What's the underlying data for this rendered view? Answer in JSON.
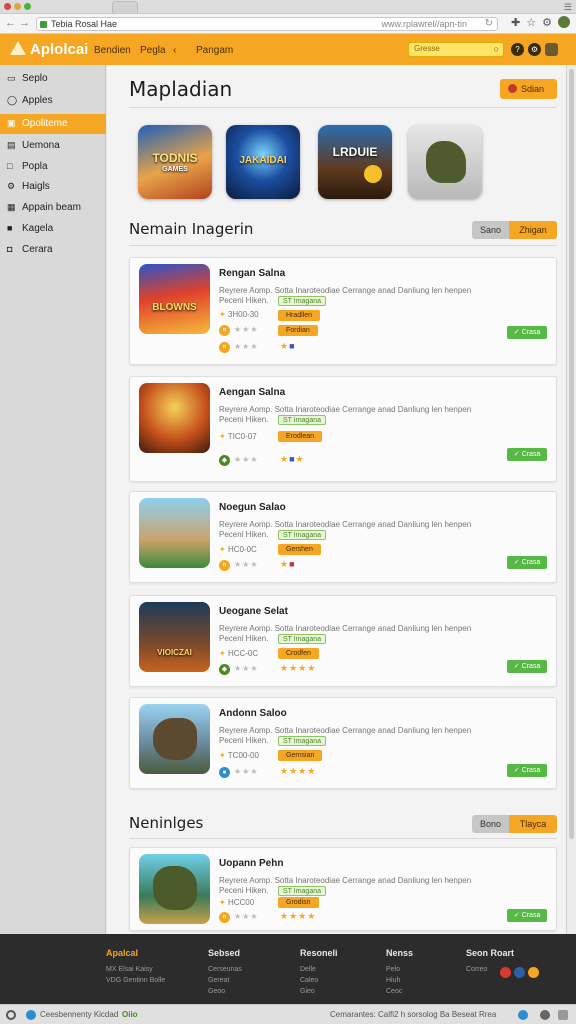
{
  "browser": {
    "tab_title": "Tebia Rosal Hae",
    "url": "www.rplawrel//apn-tin",
    "back_icon": "arrow-left-icon",
    "forward_icon": "arrow-right-icon"
  },
  "header": {
    "logo": "Aplolcai",
    "nav": [
      "Bendien",
      "Pegla"
    ],
    "nav_right": "Pangam",
    "search_placeholder": "Gresse"
  },
  "sidebar": {
    "items": [
      {
        "label": "Seplo",
        "icon": "folder-icon"
      },
      {
        "label": "Apples",
        "icon": "circle-icon"
      },
      {
        "label": "Opoliteme",
        "icon": "monitor-icon",
        "active": true
      },
      {
        "label": "Uemona",
        "icon": "doc-icon"
      },
      {
        "label": "Popla",
        "icon": "square-icon"
      },
      {
        "label": "Haigls",
        "icon": "gear-icon"
      },
      {
        "label": "Appain beam",
        "icon": "grid-icon"
      },
      {
        "label": "Kagela",
        "icon": "box-icon"
      },
      {
        "label": "Cerara",
        "icon": "camera-icon"
      }
    ]
  },
  "main": {
    "title": "Mapladian",
    "submit_label": "Sdian",
    "featured": [
      {
        "text": "TODNIS",
        "sub": "GAMES"
      },
      {
        "text": "JAKAIDAI",
        "sub": ""
      },
      {
        "text": "LRDUIE",
        "sub": ""
      },
      {
        "text": "",
        "sub": ""
      }
    ],
    "section1": {
      "title": "Nemain Inagerin",
      "seg_a": "Sano",
      "seg_b": "Zhigan"
    },
    "section2": {
      "title": "Neninlges",
      "seg_a": "Bono",
      "seg_b": "Tlayca"
    },
    "card_desc": "Reyrere Aomp. Sotta Inaroteodiae Cerrange anad Danliung len henpen",
    "card_desc2": "Peceni Hiken.",
    "green_tag": "ST Imagana",
    "install_label": "Crasa",
    "cards": [
      {
        "title": "Rengan Salna",
        "thumb_text": "BLOWNS",
        "meta": "3H00-30",
        "tag1": "Hradllen",
        "tag2": "Fordian"
      },
      {
        "title": "Aengan Salna",
        "thumb_text": "",
        "meta": "TIC0-07",
        "tag1": "Erodlean",
        "tag2": ""
      },
      {
        "title": "Noegun Salao",
        "thumb_text": "",
        "meta": "HC0-0C",
        "tag1": "Gershen",
        "tag2": ""
      },
      {
        "title": "Ueogane Selat",
        "thumb_text": "VIOICZAI",
        "meta": "HCC-0C",
        "tag1": "Crodfen",
        "tag2": ""
      },
      {
        "title": "Andonn Saloo",
        "thumb_text": "",
        "meta": "TC00-00",
        "tag1": "Gernsian",
        "tag2": ""
      },
      {
        "title": "Uopann Pehn",
        "thumb_text": "",
        "meta": "HCC00",
        "tag1": "Grodisn",
        "tag2": ""
      }
    ]
  },
  "footer": {
    "cols": [
      {
        "title": "Apalcal",
        "links": [
          "MX Elsai Kaisy",
          "VDG Gentinn Bolle"
        ]
      },
      {
        "title": "Sebsed",
        "links": [
          "Cerseunas",
          "Gereat",
          "Geoo"
        ]
      },
      {
        "title": "Resoneli",
        "links": [
          "Delle",
          "Caleo",
          "Gieo"
        ]
      },
      {
        "title": "Nenss",
        "links": [
          "Pelo",
          "Hiuh",
          "Ceoc"
        ]
      },
      {
        "title": "Seon Roart",
        "links": [
          "Correo"
        ]
      }
    ]
  },
  "statusbar": {
    "left": "Ceesbennenty Kicdad",
    "left_badge": "Oiio",
    "right": "Cemarantes: Calfi2 h sorsolog Ba Beseat Rrea"
  },
  "colors": {
    "accent": "#f5a623",
    "green": "#58b845",
    "footer": "#2c2c2c"
  }
}
